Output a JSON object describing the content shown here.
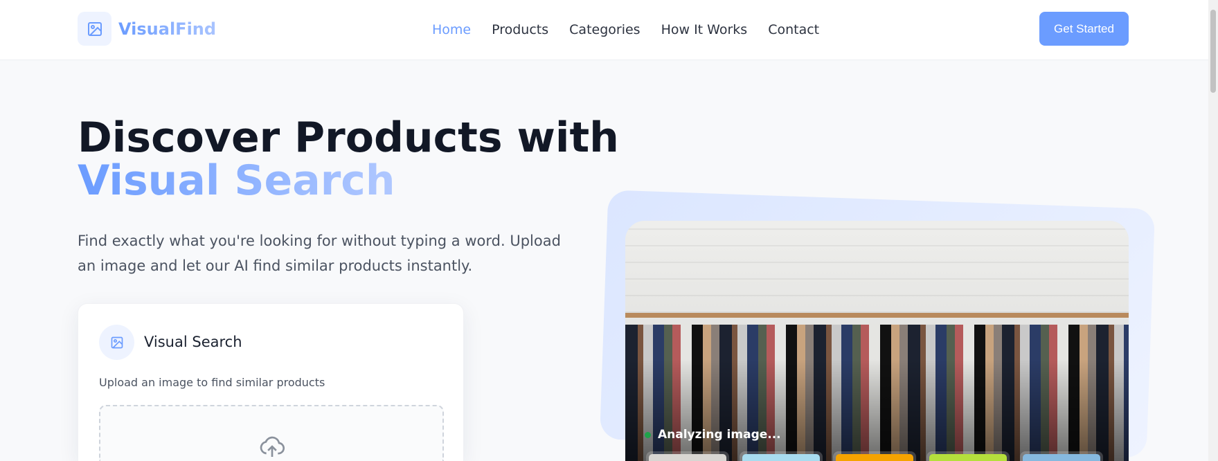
{
  "nav": {
    "brand": "VisualFind",
    "links": [
      "Home",
      "Products",
      "Categories",
      "How It Works",
      "Contact"
    ],
    "active": "Home",
    "cta": "Get Started"
  },
  "hero": {
    "title_line1": "Discover Products with",
    "title_line2": "Visual Search",
    "lead": "Find exactly what you're looking for without typing a word. Upload an image and let our AI find similar products instantly."
  },
  "search_card": {
    "title": "Visual Search",
    "subtitle": "Upload an image to find similar products"
  },
  "preview": {
    "status": "Analyzing image...",
    "status_color": "#1fa34a",
    "thumbnail_colors": [
      "#d8d6d2",
      "#a8dcef",
      "#f5a300",
      "#b5df3c",
      "#86b9df"
    ]
  },
  "colors": {
    "accent": "#6b9cff",
    "text": "#121826"
  }
}
